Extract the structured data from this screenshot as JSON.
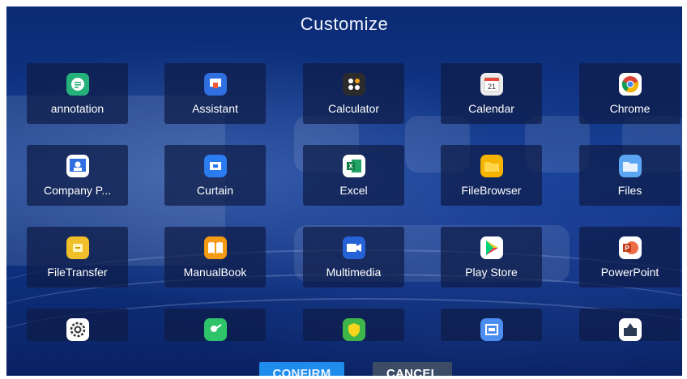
{
  "dialog": {
    "title": "Customize",
    "confirm_label": "CONFIRM",
    "cancel_label": "CANCEL"
  },
  "apps": [
    {
      "label": "annotation",
      "icon": "annotation-icon",
      "color": "#27b17a"
    },
    {
      "label": "Assistant",
      "icon": "assistant-icon",
      "color": "#2f6fe0"
    },
    {
      "label": "Calculator",
      "icon": "calculator-icon",
      "color": "#2b2b2b"
    },
    {
      "label": "Calendar",
      "icon": "calendar-icon",
      "color": "#ececec"
    },
    {
      "label": "Chrome",
      "icon": "chrome-icon",
      "color": "#ffffff"
    },
    {
      "label": "Company P...",
      "icon": "company-profile-icon",
      "color": "#ffffff"
    },
    {
      "label": "Curtain",
      "icon": "curtain-icon",
      "color": "#2a7cf0"
    },
    {
      "label": "Excel",
      "icon": "excel-icon",
      "color": "#ffffff"
    },
    {
      "label": "FileBrowser",
      "icon": "folder-icon",
      "color": "#f5b400"
    },
    {
      "label": "Files",
      "icon": "files-icon",
      "color": "#5aa6f2"
    },
    {
      "label": "FileTransfer",
      "icon": "file-transfer-icon",
      "color": "#f1bf2a"
    },
    {
      "label": "ManualBook",
      "icon": "manual-book-icon",
      "color": "#f59b12"
    },
    {
      "label": "Multimedia",
      "icon": "multimedia-icon",
      "color": "#2562d8"
    },
    {
      "label": "Play Store",
      "icon": "play-store-icon",
      "color": "#ffffff"
    },
    {
      "label": "PowerPoint",
      "icon": "powerpoint-icon",
      "color": "#ffffff"
    },
    {
      "label": "",
      "icon": "settings-icon",
      "color": "#ffffff"
    },
    {
      "label": "",
      "icon": "presentation-icon",
      "color": "#2fc46a"
    },
    {
      "label": "",
      "icon": "shield-icon",
      "color": "#3db54a"
    },
    {
      "label": "",
      "icon": "screen-capture-icon",
      "color": "#4c8ef0"
    },
    {
      "label": "",
      "icon": "toolbox-icon",
      "color": "#ffffff"
    }
  ],
  "calendar_day": "21",
  "colors": {
    "accent": "#1f8bea",
    "background": "#0d2d79"
  }
}
